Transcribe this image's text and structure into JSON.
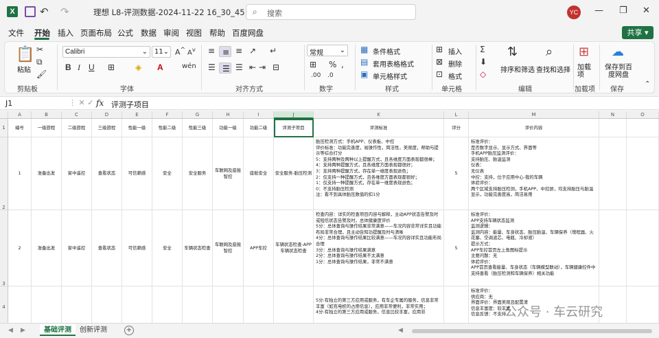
{
  "window": {
    "title": "理想 L8-评测数据-2024-11-22 16_30_45 · Excel",
    "search_placeholder": "搜索",
    "avatar_initials": "YC"
  },
  "menu": {
    "items": [
      "文件",
      "开始",
      "插入",
      "页面布局",
      "公式",
      "数据",
      "审阅",
      "视图",
      "帮助",
      "百度网盘"
    ],
    "active": "开始",
    "share_label": "共享"
  },
  "ribbon": {
    "clipboard": {
      "paste": "粘贴",
      "label": "剪贴板"
    },
    "font": {
      "name": "Calibri",
      "size": "11",
      "label": "字体"
    },
    "alignment": {
      "label": "对齐方式"
    },
    "number": {
      "format": "常规",
      "label": "数字"
    },
    "styles": {
      "conditional": "条件格式",
      "table": "套用表格格式",
      "cell_styles": "单元格样式",
      "label": "样式"
    },
    "cells": {
      "insert": "插入",
      "delete": "删除",
      "format": "格式",
      "label": "单元格"
    },
    "editing": {
      "sort": "排序和筛选",
      "find": "查找和选择",
      "label": "编辑"
    },
    "addins": {
      "btn": "加载项",
      "label": "加载项"
    },
    "save": {
      "btn": "保存到百度网盘",
      "label": "保存"
    }
  },
  "formula_bar": {
    "name_box": "J1",
    "content": "评测子项目"
  },
  "columns": [
    "A",
    "B",
    "C",
    "D",
    "E",
    "F",
    "G",
    "H",
    "I",
    "J",
    "K",
    "L",
    "M",
    "N",
    "O"
  ],
  "rows": [
    "1",
    "2",
    "3",
    "4"
  ],
  "header_row": [
    "编号",
    "一级旅程",
    "二级旅程",
    "三级旅程",
    "性能一级",
    "性能二级",
    "性能三级",
    "功能一级",
    "功能二级",
    "评测子项目",
    "评测标准",
    "评分",
    "评价内容",
    "",
    ""
  ],
  "row2": {
    "a": "1",
    "b": "准备出发",
    "c": "家中遥控",
    "d": "查看状态",
    "e": "可信赖感",
    "f": "安全",
    "g": "安全服务",
    "h": "车联网及座舱智控",
    "i": "座舱安全",
    "j": "安全服务-胎压检测",
    "k": "胎压检测方式：手机APP、仪表板、中控\n评价标准：功能完善度，易操作性，简洁性，美观度，帮助与提示等综合打分\n5：支持两种及两种以上提醒方式，且各维度方面表现都很棒；\n4：支持两种提醒方式，且各维度方面表现都很好；\n3：支持两种提醒方式，存在单一维度表现逊色；\n2：仅支持一种提醒方式，且各维度方面表现都很好；\n1：仅支持一种提醒方式，存在单一维度表现逊色；\n0：不支持胎压检测\n注：看不到具体胎压数值的扣1分",
    "l": "5",
    "m": "标准评价：\n是否数字显示、显示方式、界面等\n手机APP胎压监测评价：\n支持胎压、胎温监测\n仪表：\n无仪表\n中控：支持，位于应用中心-我的车辆\n体验评价：\n两个区域支持胎压检测，手机APP、中控屏，均支持胎压与胎温显示，功能完善度高，简洁易用"
  },
  "row3": {
    "a": "2",
    "b": "准备出发",
    "c": "家中遥控",
    "d": "查看状态",
    "e": "可信赖感",
    "f": "安全",
    "g": "车辆状态检查",
    "h": "车联网及座舱智控",
    "i": "APP车控",
    "j": "车辆状态检查-APP车辆状态检查",
    "k": "检查内容：详实的检查项目内容与解释，主动APP状态告警及时或短信状态告警及时，总体健康度评价\n5分：总体查询与操作结果非常满意——车况内容非常详实且功能布局非常合理，且主动告知功提醒及时与清晰\n4分：总体查询与操作结果比较满意——车况内容详实且功能布局合理\n3分：总体查询与操作结果满意\n2分：总体查询与操作结果不太满意\n1分：总体查询与操作结果，非常不满意",
    "l": "5",
    "m": "标准评价：\nAPP支持车辆状态监测\n监测逻辑：\n监测内容：能量、车身状态、胎压胎温、车辆保养（增程器、火花塞、空调滤芯、电瓶、冷却液）\n提示方式：\nAPP车控首页左上角图标提示\n主要问题：无\n体验评价：\nAPP首页查看能量、车身状态（车辆模型联动），车辆健康控件中支持查看（胎压检测和车辆保养）相关功能"
  },
  "row4": {
    "k": "5分:有独立的第三方应用或服务，有车企专属的服务，信息非常丰富（如充电桩的占用信息），应用非常便利，非常实用；\n4分:有独立的第三方应用或服务，信息比较丰富，应用非",
    "m": "标准评价：\n供应商：无\n界面评价：界面美观且配置清\n信息丰富度：较丰富\n信息反馈：不支持"
  },
  "sheets": {
    "tabs": [
      "基础评测",
      "创新评测"
    ],
    "active": "基础评测"
  },
  "watermark": "公众号 · 车云研究"
}
